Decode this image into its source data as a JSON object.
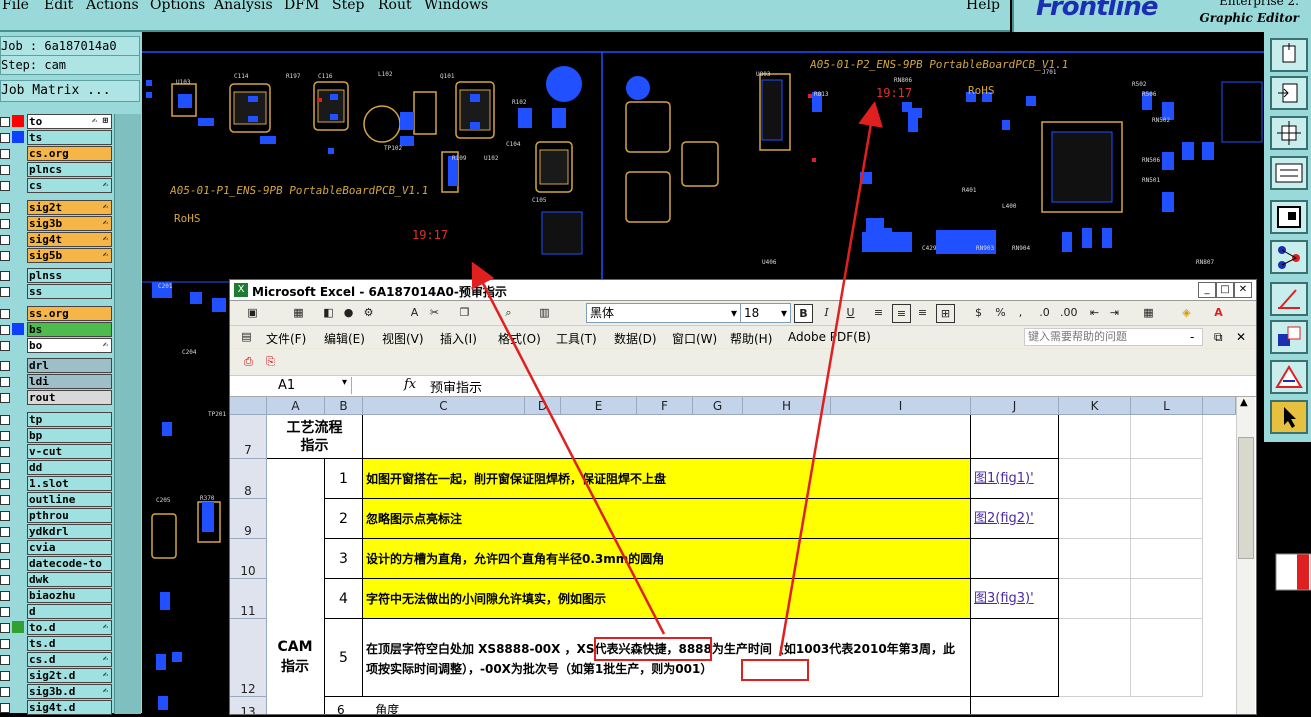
{
  "menubar": {
    "items": [
      "File",
      "Edit",
      "Actions",
      "Options",
      "Analysis",
      "DFM",
      "Step",
      "Rout",
      "Windows"
    ],
    "help": "Help"
  },
  "brand": {
    "logo": "Frontline",
    "subtitle": "Graphic Editor",
    "topline": "Enterprise 2."
  },
  "leftpanel": {
    "job": "Job : 6a187014a0",
    "step": "Step: cam",
    "job_matrix": "Job Matrix ...",
    "layers": [
      {
        "name": "to",
        "swatch": "#ff0000",
        "fill": "#ffffff",
        "hand": "✍ ⊞"
      },
      {
        "name": "ts",
        "swatch": "#1040ff",
        "fill": "#9fe0e0",
        "hand": ""
      },
      {
        "name": "cs.org",
        "swatch": "",
        "fill": "#f5b547",
        "hand": ""
      },
      {
        "name": "plncs",
        "swatch": "",
        "fill": "#9fe0e0",
        "hand": ""
      },
      {
        "name": "cs",
        "swatch": "",
        "fill": "#9fe0e0",
        "hand": "✍"
      },
      {
        "name": "sig2t",
        "swatch": "",
        "fill": "#f5b547",
        "hand": "✍"
      },
      {
        "name": "sig3b",
        "swatch": "",
        "fill": "#f5b547",
        "hand": "✍"
      },
      {
        "name": "sig4t",
        "swatch": "",
        "fill": "#f5b547",
        "hand": "✍"
      },
      {
        "name": "sig5b",
        "swatch": "",
        "fill": "#f5b547",
        "hand": "✍"
      },
      {
        "name": "plnss",
        "swatch": "",
        "fill": "#9fe0e0",
        "hand": ""
      },
      {
        "name": "ss",
        "swatch": "",
        "fill": "#9fe0e0",
        "hand": ""
      },
      {
        "name": "ss.org",
        "swatch": "",
        "fill": "#f5b547",
        "hand": ""
      },
      {
        "name": "bs",
        "swatch": "#1040ff",
        "fill": "#4dbb4d",
        "hand": ""
      },
      {
        "name": "bo",
        "swatch": "",
        "fill": "#ffffff",
        "hand": "✍"
      },
      {
        "name": "drl",
        "swatch": "",
        "fill": "#9fbfc8",
        "hand": ""
      },
      {
        "name": "ldi",
        "swatch": "",
        "fill": "#9fbfc8",
        "hand": ""
      },
      {
        "name": "rout",
        "swatch": "",
        "fill": "#d9d9d9",
        "hand": ""
      },
      {
        "name": "tp",
        "swatch": "",
        "fill": "#9fe0e0",
        "hand": ""
      },
      {
        "name": "bp",
        "swatch": "",
        "fill": "#9fe0e0",
        "hand": ""
      },
      {
        "name": "v-cut",
        "swatch": "",
        "fill": "#9fe0e0",
        "hand": ""
      },
      {
        "name": "dd",
        "swatch": "",
        "fill": "#9fe0e0",
        "hand": ""
      },
      {
        "name": "1.slot",
        "swatch": "",
        "fill": "#9fe0e0",
        "hand": ""
      },
      {
        "name": "outline",
        "swatch": "",
        "fill": "#9fe0e0",
        "hand": ""
      },
      {
        "name": "pthrou",
        "swatch": "",
        "fill": "#9fe0e0",
        "hand": ""
      },
      {
        "name": "ydkdrl",
        "swatch": "",
        "fill": "#9fe0e0",
        "hand": ""
      },
      {
        "name": "cvia",
        "swatch": "",
        "fill": "#9fe0e0",
        "hand": ""
      },
      {
        "name": "datecode-to",
        "swatch": "",
        "fill": "#9fe0e0",
        "hand": ""
      },
      {
        "name": "dwk",
        "swatch": "",
        "fill": "#9fe0e0",
        "hand": ""
      },
      {
        "name": "biaozhu",
        "swatch": "",
        "fill": "#9fe0e0",
        "hand": ""
      },
      {
        "name": "d",
        "swatch": "",
        "fill": "#9fe0e0",
        "hand": ""
      },
      {
        "name": "to.d",
        "swatch": "#30a030",
        "fill": "#9fe0e0",
        "hand": "✍"
      },
      {
        "name": "ts.d",
        "swatch": "",
        "fill": "#9fe0e0",
        "hand": ""
      },
      {
        "name": "cs.d",
        "swatch": "",
        "fill": "#9fe0e0",
        "hand": "✍"
      },
      {
        "name": "sig2t.d",
        "swatch": "",
        "fill": "#9fe0e0",
        "hand": "✍"
      },
      {
        "name": "sig3b.d",
        "swatch": "",
        "fill": "#9fe0e0",
        "hand": "✍"
      },
      {
        "name": "sig4t.d",
        "swatch": "",
        "fill": "#9fe0e0",
        "hand": ""
      }
    ]
  },
  "pcb": {
    "board_label_1": "A05-01-P1_ENS-9PB PortableBoardPCB_V1.1",
    "board_label_2": "A05-01-P2_ENS-9PB PortableBoardPCB_V1.1",
    "rohs": "RoHS",
    "date_code": "19:17"
  },
  "excel": {
    "title": "Microsoft Excel - 6A187014A0-预审指示",
    "font": "黑体",
    "size": "18",
    "menu": [
      "文件(F)",
      "编辑(E)",
      "视图(V)",
      "插入(I)",
      "格式(O)",
      "工具(T)",
      "数据(D)",
      "窗口(W)",
      "帮助(H)",
      "Adobe PDF(B)"
    ],
    "help_placeholder": "键入需要帮助的问题",
    "namebox": "A1",
    "fx": "fx",
    "formula": "预审指示",
    "columns": [
      "A",
      "B",
      "C",
      "D",
      "E",
      "F",
      "G",
      "H",
      "I",
      "J",
      "K",
      "L"
    ],
    "rows": [
      {
        "num": "7",
        "a": "工艺流程\n指示",
        "b": "",
        "c": "",
        "j": ""
      },
      {
        "num": "8",
        "b": "1",
        "c": "如图开窗搭在一起，削开窗保证阻焊桥，保证阻焊不上盘",
        "j": "图1(fig1)'"
      },
      {
        "num": "9",
        "b": "2",
        "c": "忽略图示点亮标注",
        "j": "图2(fig2)'"
      },
      {
        "num": "10",
        "b": "3",
        "c": "设计的方槽为直角，允许四个直角有半径0.3mm的圆角",
        "j": ""
      },
      {
        "num": "11",
        "b": "4",
        "c": "字符中无法做出的小间隙允许填实，例如图示",
        "j": "图3(fig3)'"
      },
      {
        "num": "12",
        "b": "5",
        "c": "在顶层字符空白处加 XS8888-00X ，XS代表兴森快捷，8888为生产时间（如1003代表2010年第3周，此项按实际时间调整），-00X为批次号（如第1批生产，则为001）",
        "j": ""
      }
    ],
    "cam_label": "CAM\n指示",
    "partial_row": "6        角度",
    "partial_row_num": "13"
  }
}
